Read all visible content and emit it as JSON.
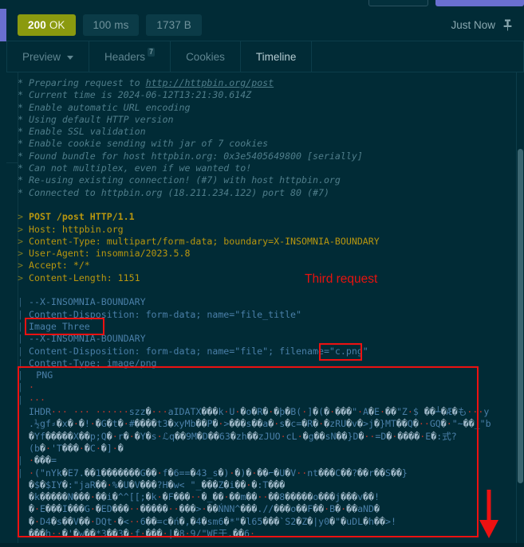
{
  "window": {
    "background_color": "#012b36",
    "accent_color": "#6a6fd0"
  },
  "status_bar": {
    "status_code": "200",
    "status_text": "OK",
    "time": "100 ms",
    "size": "1737 B",
    "timestamp": "Just Now",
    "pin_icon": "pin-icon",
    "status_color": "#8b9a0f"
  },
  "tabs": [
    {
      "label": "Preview",
      "has_caret": true,
      "badge": "",
      "active": false
    },
    {
      "label": "Headers",
      "has_caret": false,
      "badge": "7",
      "active": false
    },
    {
      "label": "Cookies",
      "has_caret": false,
      "badge": "",
      "active": false
    },
    {
      "label": "Timeline",
      "has_caret": false,
      "badge": "",
      "active": true
    }
  ],
  "timeline": {
    "info_lines": [
      {
        "gutter": "*",
        "text": "Preparing request to ",
        "link": "http://httpbin.org/post"
      },
      {
        "gutter": "*",
        "text": "Current time is 2024-06-12T13:21:30.614Z",
        "link": ""
      },
      {
        "gutter": "*",
        "text": "Enable automatic URL encoding",
        "link": ""
      },
      {
        "gutter": "*",
        "text": "Using default HTTP version",
        "link": ""
      },
      {
        "gutter": "*",
        "text": "Enable SSL validation",
        "link": ""
      },
      {
        "gutter": "*",
        "text": "Enable cookie sending with jar of 7 cookies",
        "link": ""
      },
      {
        "gutter": "*",
        "text": "Found bundle for host httpbin.org: 0x3e5405649800 [serially]",
        "link": ""
      },
      {
        "gutter": "*",
        "text": "Can not multiplex, even if we wanted to!",
        "link": ""
      },
      {
        "gutter": "*",
        "text": "Re-using existing connection! (#7) with host httpbin.org",
        "link": ""
      },
      {
        "gutter": "*",
        "text": "Connected to httpbin.org (18.211.234.122) port 80 (#7)",
        "link": ""
      }
    ],
    "request_lines": [
      {
        "gutter": ">",
        "text": "POST /post HTTP/1.1",
        "bold": true
      },
      {
        "gutter": ">",
        "text": "Host: httpbin.org",
        "bold": false
      },
      {
        "gutter": ">",
        "text": "Content-Type: multipart/form-data; boundary=X-INSOMNIA-BOUNDARY",
        "bold": false
      },
      {
        "gutter": ">",
        "text": "User-Agent: insomnia/2023.5.8",
        "bold": false
      },
      {
        "gutter": ">",
        "text": "Accept: */*",
        "bold": false
      },
      {
        "gutter": ">",
        "text": "Content-Length: 1151",
        "bold": false
      }
    ],
    "body_lines": [
      {
        "gutter": "|",
        "text": "--X-INSOMNIA-BOUNDARY"
      },
      {
        "gutter": "|",
        "text": "Content-Disposition: form-data; name=\"file_title\""
      },
      {
        "gutter": "|",
        "text": "Image Three"
      },
      {
        "gutter": "|",
        "text": "--X-INSOMNIA-BOUNDARY"
      },
      {
        "gutter": "|",
        "text": "Content-Disposition: form-data; name=\"file\"; filename=\"c.png\""
      },
      {
        "gutter": "|",
        "text": "Content-Type: image/png"
      }
    ],
    "binary_lines": [
      {
        "gutter": "|",
        "text": "PNG"
      },
      {
        "gutter": "|",
        "text": "·"
      },
      {
        "gutter": "|",
        "text": "···"
      },
      {
        "gutter": "",
        "text": "IHDR··· ··· ······szz�···aIDATX���k·U·�o�R�·�þ�B(·]�(�·���\"·A�E·��\"Z·$ ��┴�Æ�も···y"
      },
      {
        "gutter": "",
        "text": ".½gf⸗�x�·�!·�G�t�·#����t3�xyMb��P�·>���s��a�·s�c=�R�·�zRU�v�>j�}MT��Q�··GQ�·\"~��_\"b"
      },
      {
        "gutter": "",
        "text": "�Yf�����X��p;Q�·r�·�Y�s·ℒq��9M�D��63�zh��zJUO·cL·�g��sN��}D�··=D�·����·E�:式?"
      },
      {
        "gutter": "",
        "text": "(b�·'T���·�C·�]·�"
      },
      {
        "gutter": "|",
        "text": "·���="
      },
      {
        "gutter": "|",
        "text": "·(\"nYk�E7.��1�������G��·f�6==�43_s�)·�)�·��⌐�U�V··nt���C��?��r��S��}"
      },
      {
        "gutter": "",
        "text": "�$�$IY�:\"jaR��·%�U�V���?H�w< \"_���Z�i��·�:T���"
      },
      {
        "gutter": "",
        "text": "�k�����N���·��i�^^[[;�k·�F���··�_��·��m��··��8�����o���j���v��!"
      },
      {
        "gutter": "",
        "text": "�·E���I���G·�ED���··�����··���>·��ŃNN^���.//���o��F��·B�·��aND�"
      },
      {
        "gutter": "",
        "text": "�·D4�s��V��·DQt·�<··6��=c�ń�,�4�sm6�*\"�l65���`S2�Z�|y0�\"�uDL�h��>!"
      },
      {
        "gutter": "",
        "text": "���h··�'�w��*3��3�·f·���·|�8·9/\"WE于.��6·"
      }
    ]
  },
  "annotations": {
    "label": "Third request",
    "label_color": "#e8130f",
    "box_color": "#ee1111",
    "boxes": [
      {
        "name": "image-three-highlight"
      },
      {
        "name": "filename-highlight"
      },
      {
        "name": "binary-payload-highlight"
      }
    ],
    "arrow": {
      "name": "down-arrow",
      "direction": "down"
    }
  }
}
